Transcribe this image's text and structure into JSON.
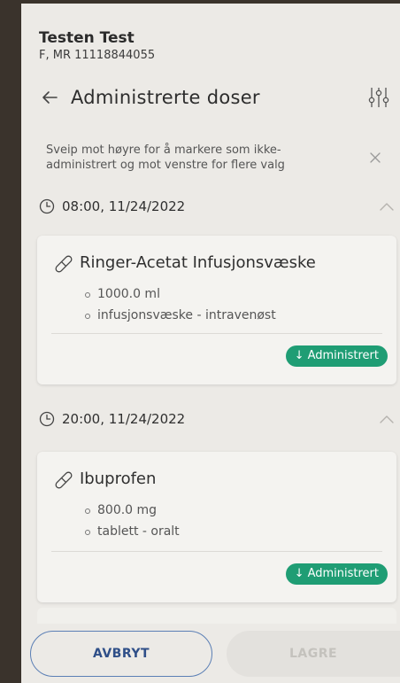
{
  "patient": {
    "name": "Testen Test",
    "id_line": "F, MR 11118844055"
  },
  "header": {
    "title": "Administrerte doser",
    "back_icon": "arrow-left-icon",
    "filter_icon": "sliders-icon"
  },
  "info_banner": {
    "text": "Sveip mot høyre for å markere som ikke-administrert og mot venstre for flere valg",
    "close_icon": "close-icon"
  },
  "groups": [
    {
      "time": "08:00, 11/24/2022",
      "doses": [
        {
          "name": "Ringer-Acetat Infusjonsvæske",
          "details": [
            "1000.0 ml",
            "infusjonsvæske - intravenøst"
          ],
          "status": "↓ Administrert"
        }
      ]
    },
    {
      "time": "20:00, 11/24/2022",
      "doses": [
        {
          "name": "Ibuprofen",
          "details": [
            "800.0 mg",
            "tablett - oralt"
          ],
          "status": "↓ Administrert"
        }
      ]
    }
  ],
  "footer": {
    "cancel_label": "AVBRYT",
    "save_label": "LAGRE"
  },
  "colors": {
    "accent_green": "#1f9d74",
    "primary_blue": "#2f4f88",
    "background": "#eceae6"
  }
}
